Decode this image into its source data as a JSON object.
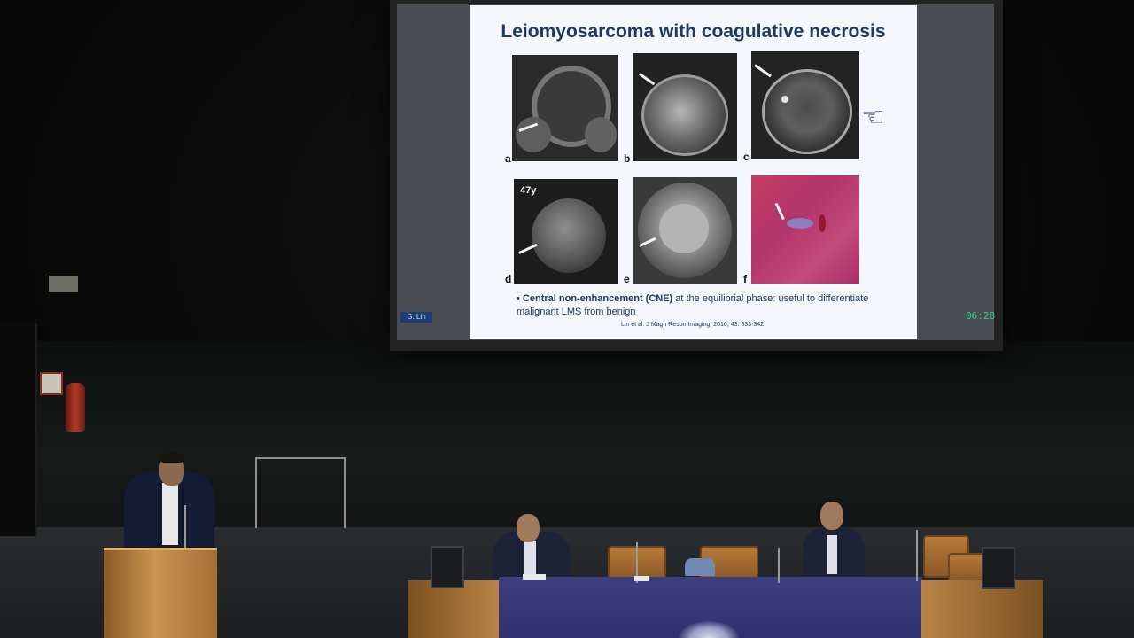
{
  "slide": {
    "title": "Leiomyosarcoma with coagulative necrosis",
    "panels": [
      {
        "letter": "a"
      },
      {
        "letter": "b"
      },
      {
        "letter": "c"
      },
      {
        "letter": "d",
        "age": "47y"
      },
      {
        "letter": "e"
      },
      {
        "letter": "f"
      }
    ],
    "bullet_bold": "Central non-enhancement (CNE)",
    "bullet_rest": " at the equilibrial phase: useful to differentiate malignant LMS from benign",
    "citation": "Lin et al. J Magn Reson Imaging. 2016; 43: 333-342.",
    "pointer_icon": "pointing-hand-icon"
  },
  "screen": {
    "speaker_tag": "G. Lin",
    "timer": "06:28"
  },
  "colors": {
    "slide_title": "#1f3864",
    "table_cloth": "#3d3f7e",
    "timer": "#34d08a",
    "speaker_tag_bg": "#1d3d78"
  }
}
